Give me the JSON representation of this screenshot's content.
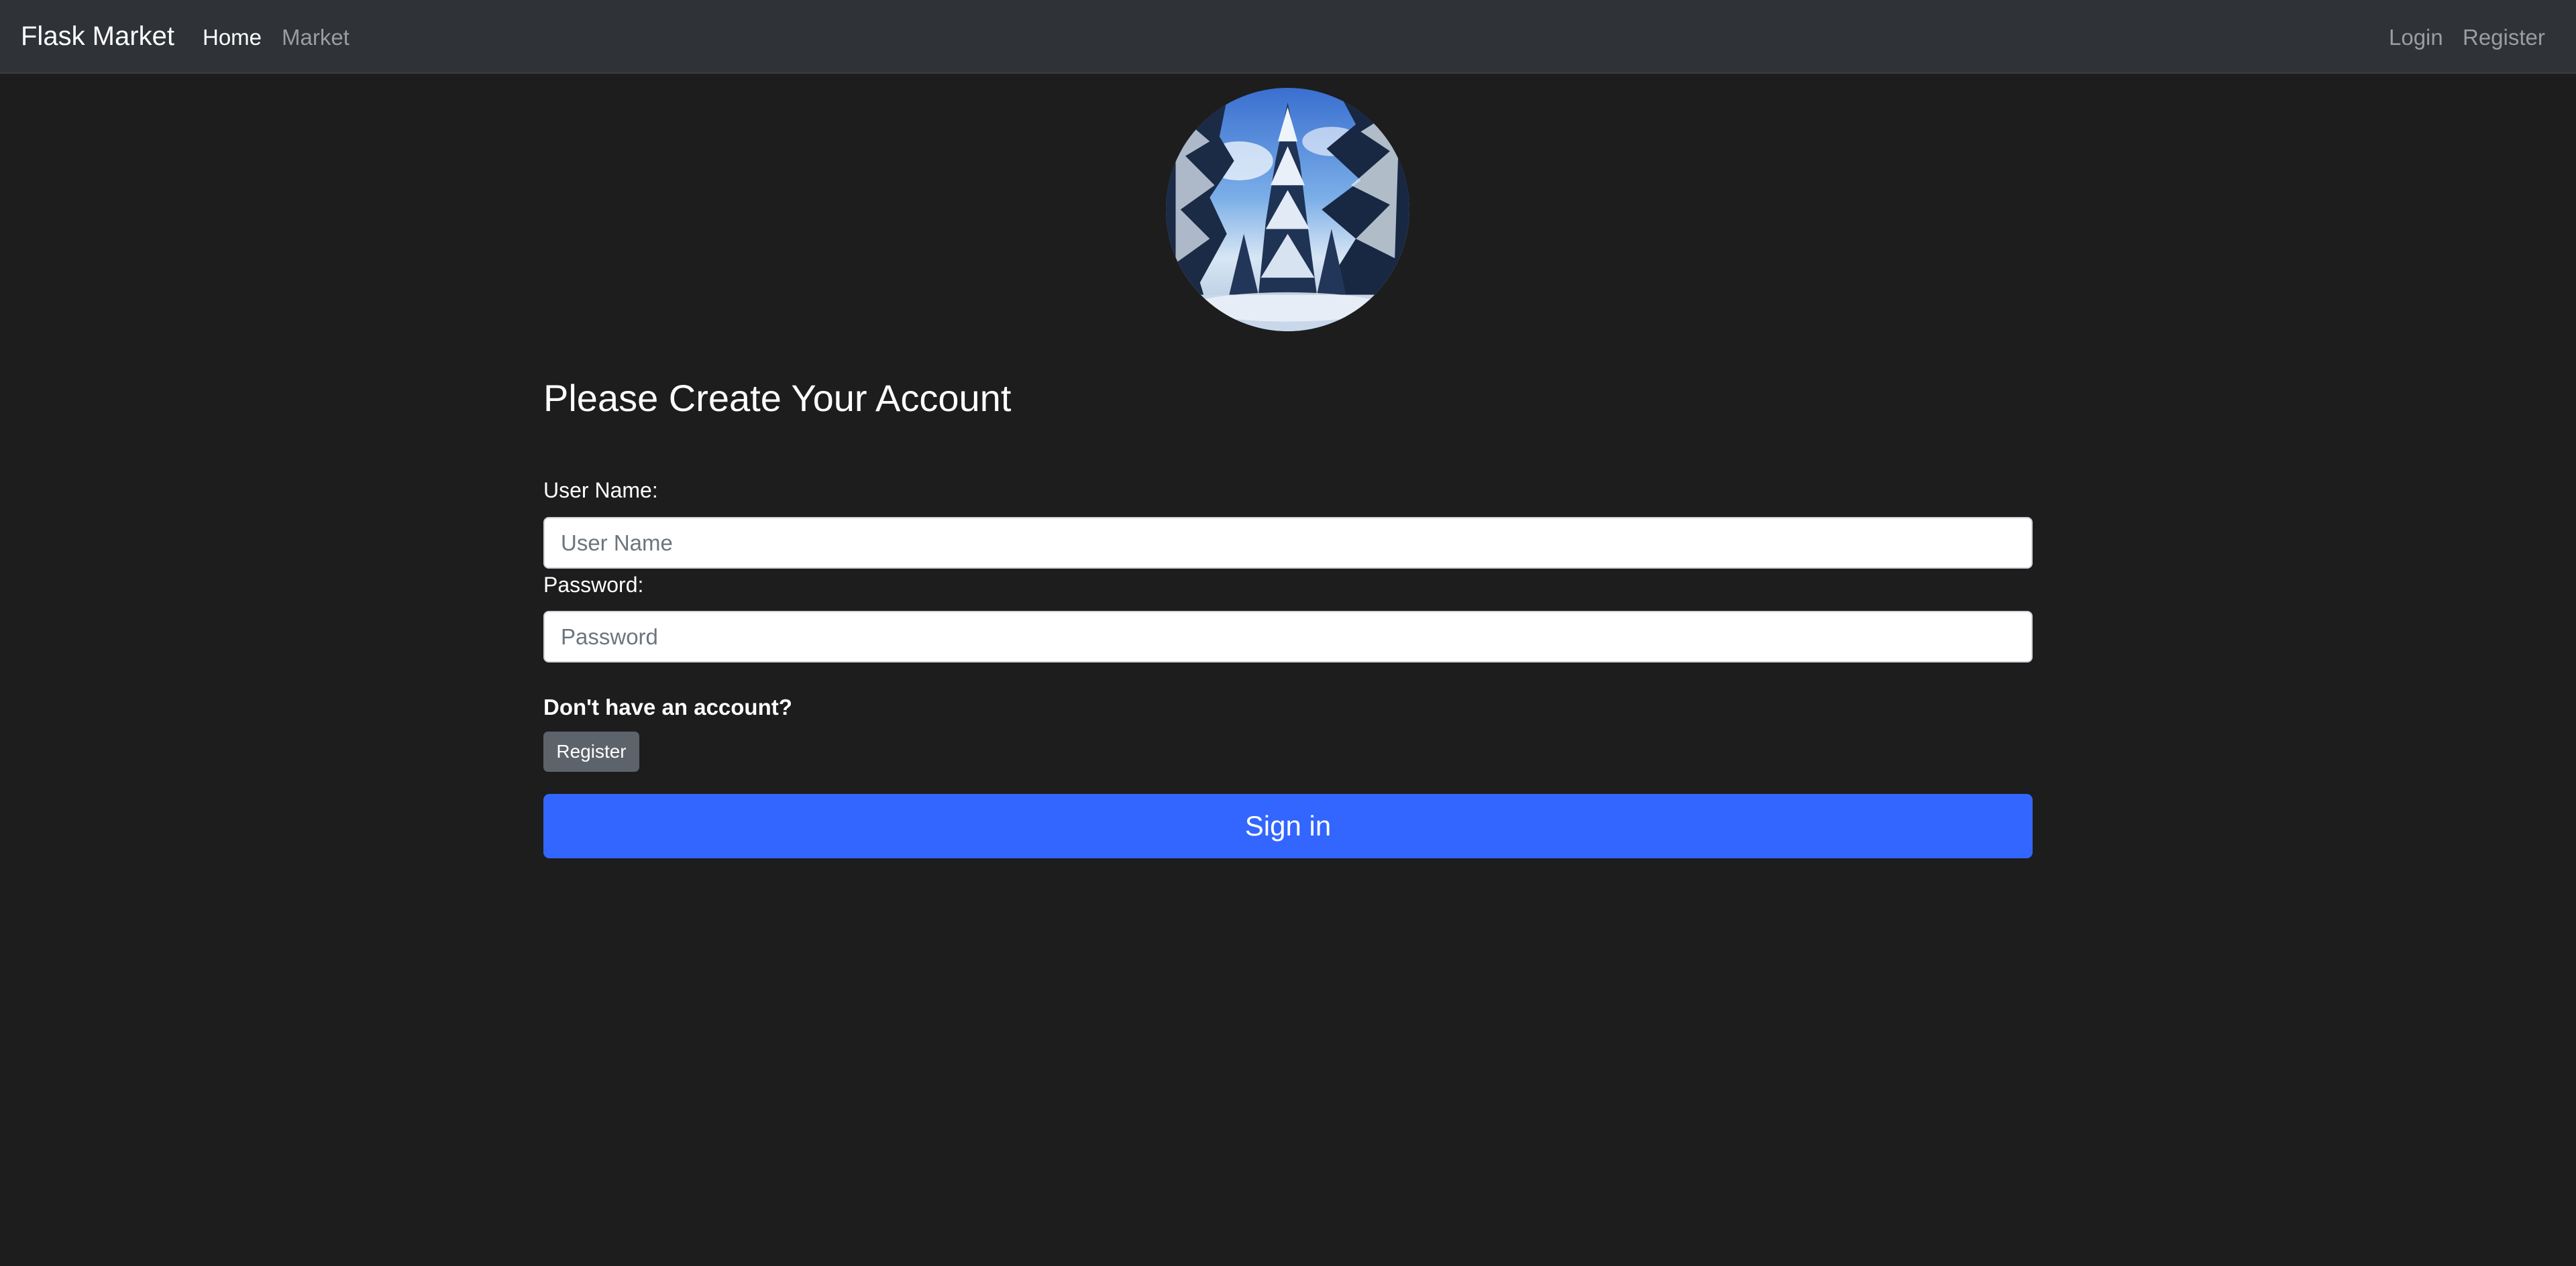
{
  "navbar": {
    "brand": "Flask Market",
    "left_links": [
      {
        "label": "Home",
        "active": true
      },
      {
        "label": "Market",
        "active": false
      }
    ],
    "right_links": [
      {
        "label": "Login"
      },
      {
        "label": "Register"
      }
    ]
  },
  "profile": {
    "image": "snowy-forest-image"
  },
  "form": {
    "title": "Please Create Your Account",
    "username": {
      "label": "User Name:",
      "placeholder": "User Name",
      "value": ""
    },
    "password": {
      "label": "Password:",
      "placeholder": "Password",
      "value": ""
    },
    "no_account_text": "Don't have an account?",
    "register_button": "Register",
    "submit_button": "Sign in"
  },
  "colors": {
    "background": "#1d1d1e",
    "navbar": "#2f3237",
    "primary": "#3366ff",
    "secondary": "#5c636a"
  }
}
